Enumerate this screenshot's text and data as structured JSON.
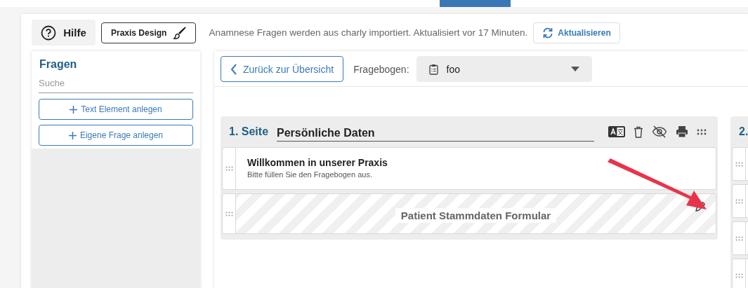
{
  "toolbar": {
    "help_button": "Hilfe",
    "design_button": "Praxis Design",
    "info": "Anamnese Fragen werden aus charly importiert. Aktualisiert vor 17 Minuten.",
    "refresh_button": "Aktualisieren"
  },
  "sidebar": {
    "title": "Fragen",
    "search": {
      "placeholder": "Suche"
    },
    "buttons": [
      {
        "label": "Text Element anlegen"
      },
      {
        "label": "Eigene Frage anlegen"
      }
    ]
  },
  "editor": {
    "back_button": "Zurück zur Übersicht",
    "questionnaire_label": "Fragebogen:",
    "questionnaire_select": {
      "value": "foo"
    },
    "pages": [
      {
        "number": "1. Seite",
        "title": "Persönliche Daten",
        "elements": [
          {
            "kind": "text",
            "title": "Willkommen in unserer Praxis",
            "subtitle": "Bitte füllen Sie den Fragebogen aus."
          },
          {
            "kind": "form",
            "title": "Patient Stammdaten Formular"
          }
        ]
      },
      {
        "number": "2.",
        "elements": [
          {
            "kind": "blank"
          },
          {
            "kind": "blank"
          },
          {
            "kind": "blank"
          },
          {
            "kind": "blank"
          }
        ]
      }
    ]
  }
}
